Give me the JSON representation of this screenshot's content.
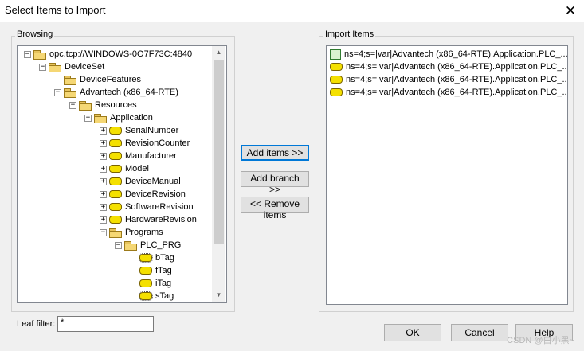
{
  "window": {
    "title": "Select Items to Import",
    "close_glyph": "✕"
  },
  "browsing": {
    "label": "Browsing",
    "tree": [
      {
        "label": "opc.tcp://WINDOWS-0O7F73C:4840",
        "level": 0,
        "icon": "folder-icon",
        "expander": "minus"
      },
      {
        "label": "DeviceSet",
        "level": 1,
        "icon": "folder-icon",
        "expander": "minus"
      },
      {
        "label": "DeviceFeatures",
        "level": 2,
        "icon": "folder-icon",
        "expander": "none"
      },
      {
        "label": "Advantech (x86_64-RTE)",
        "level": 2,
        "icon": "folder-icon",
        "expander": "minus"
      },
      {
        "label": "Resources",
        "level": 3,
        "icon": "folder-icon",
        "expander": "minus"
      },
      {
        "label": "Application",
        "level": 4,
        "icon": "folder-icon",
        "expander": "minus"
      },
      {
        "label": "SerialNumber",
        "level": 5,
        "icon": "tag-icon",
        "expander": "plus"
      },
      {
        "label": "RevisionCounter",
        "level": 5,
        "icon": "tag-icon",
        "expander": "plus"
      },
      {
        "label": "Manufacturer",
        "level": 5,
        "icon": "tag-icon",
        "expander": "plus"
      },
      {
        "label": "Model",
        "level": 5,
        "icon": "tag-icon",
        "expander": "plus"
      },
      {
        "label": "DeviceManual",
        "level": 5,
        "icon": "tag-icon",
        "expander": "plus"
      },
      {
        "label": "DeviceRevision",
        "level": 5,
        "icon": "tag-icon",
        "expander": "plus"
      },
      {
        "label": "SoftwareRevision",
        "level": 5,
        "icon": "tag-icon",
        "expander": "plus"
      },
      {
        "label": "HardwareRevision",
        "level": 5,
        "icon": "tag-icon",
        "expander": "plus"
      },
      {
        "label": "Programs",
        "level": 5,
        "icon": "folder-icon",
        "expander": "minus"
      },
      {
        "label": "PLC_PRG",
        "level": 6,
        "icon": "folder-icon",
        "expander": "minus"
      },
      {
        "label": "bTag",
        "level": 7,
        "icon": "tag-icon",
        "expander": "none",
        "selected": true
      },
      {
        "label": "fTag",
        "level": 7,
        "icon": "tag-icon",
        "expander": "none"
      },
      {
        "label": "iTag",
        "level": 7,
        "icon": "tag-icon",
        "expander": "none"
      },
      {
        "label": "sTag",
        "level": 7,
        "icon": "tag-icon",
        "expander": "none",
        "selected": true
      }
    ]
  },
  "buttons": {
    "add_items": "Add items >>",
    "add_branch": "Add branch >>",
    "remove_items": "<< Remove items",
    "ok": "OK",
    "cancel": "Cancel",
    "help": "Help"
  },
  "import": {
    "label": "Import Items",
    "items": [
      "ns=4;s=|var|Advantech (x86_64-RTE).Application.PLC_...",
      "ns=4;s=|var|Advantech (x86_64-RTE).Application.PLC_...",
      "ns=4;s=|var|Advantech (x86_64-RTE).Application.PLC_...",
      "ns=4;s=|var|Advantech (x86_64-RTE).Application.PLC_..."
    ]
  },
  "leaf_filter": {
    "label": "Leaf filter:",
    "value": "*"
  },
  "watermark": "CSDN @白小黑~",
  "colors": {
    "accent": "#0078d7",
    "tag_fill": "#f4e000",
    "folder_fill": "#f5d774"
  }
}
